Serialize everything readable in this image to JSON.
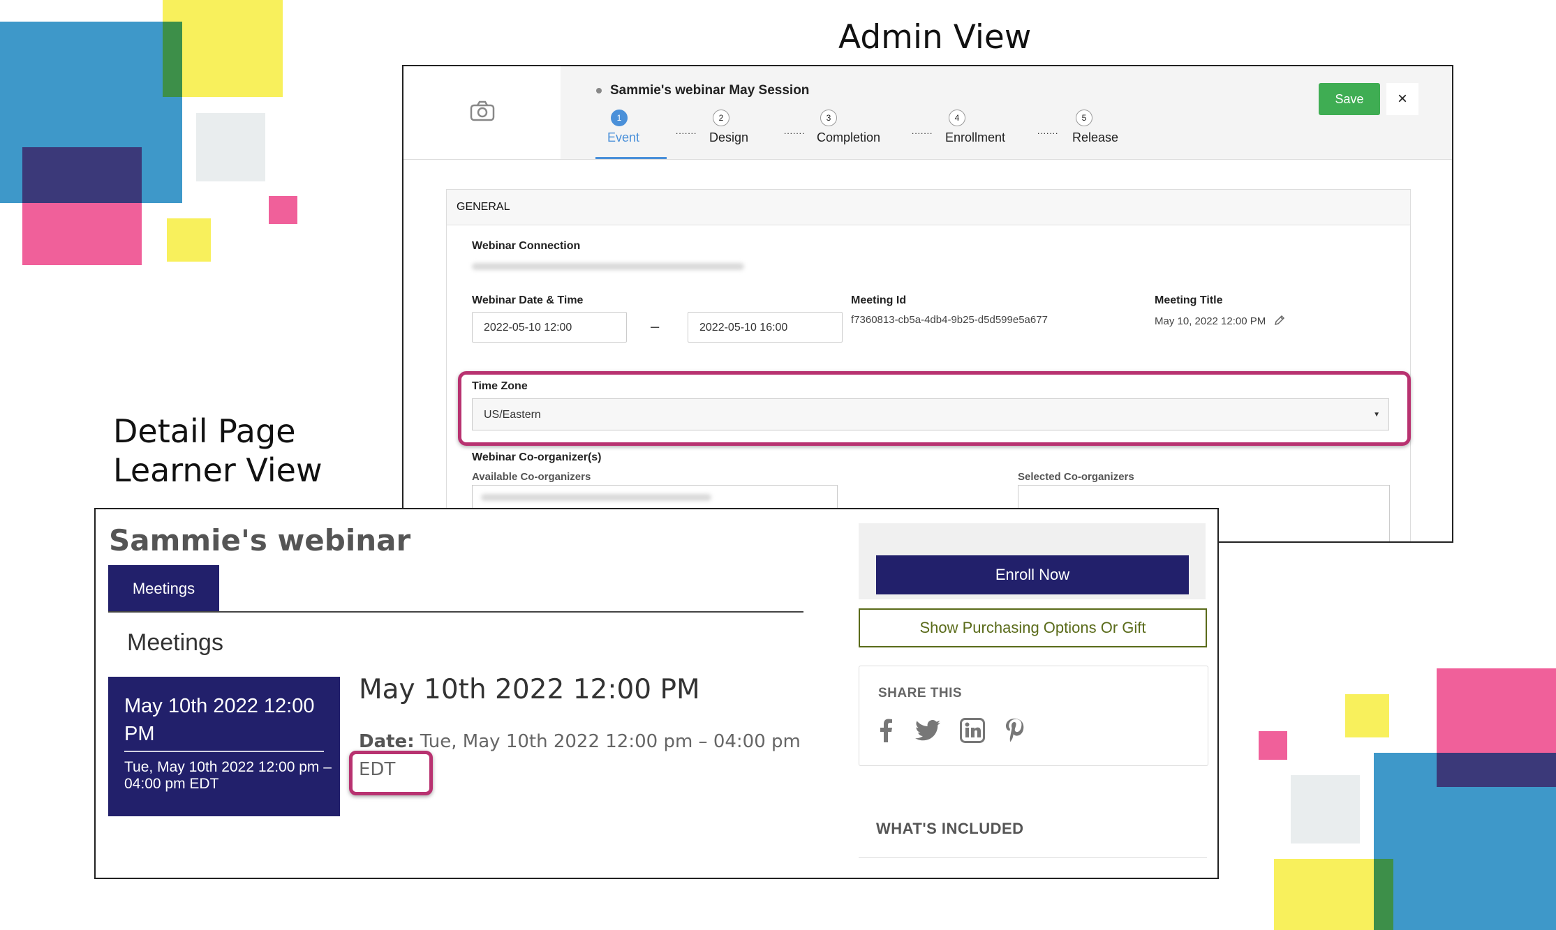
{
  "captions": {
    "admin_view": "Admin View",
    "detail_line1": "Detail Page",
    "detail_line2": "Learner View"
  },
  "admin": {
    "event_title": "Sammie's webinar May Session",
    "steps": [
      {
        "num": "1",
        "label": "Event",
        "active": true
      },
      {
        "num": "2",
        "label": "Design"
      },
      {
        "num": "3",
        "label": "Completion"
      },
      {
        "num": "4",
        "label": "Enrollment"
      },
      {
        "num": "5",
        "label": "Release"
      }
    ],
    "save_label": "Save",
    "close_label": "×",
    "general": {
      "header": "GENERAL",
      "webinar_connection_label": "Webinar Connection",
      "date_time_label": "Webinar Date & Time",
      "start_value": "2022-05-10 12:00",
      "range_sep": "–",
      "end_value": "2022-05-10 16:00",
      "meeting_id_label": "Meeting Id",
      "meeting_id_value": "f7360813-cb5a-4db4-9b25-d5d599e5a677",
      "meeting_title_label": "Meeting Title",
      "meeting_title_value": "May 10, 2022 12:00 PM",
      "time_zone_label": "Time Zone",
      "time_zone_value": "US/Eastern",
      "co_organizers_label": "Webinar Co-organizer(s)",
      "available_label": "Available Co-organizers",
      "selected_label": "Selected Co-organizers"
    }
  },
  "learner": {
    "course_title": "Sammie's webinar",
    "tab_label": "Meetings",
    "section_heading": "Meetings",
    "card_big": "May 10th 2022 12:00 PM",
    "card_small": "Tue, May 10th 2022 12:00 pm – 04:00 pm EDT",
    "meeting_heading": "May 10th 2022 12:00 PM",
    "date_label": "Date:",
    "date_value": " Tue, May 10th 2022 12:00 pm – 04:00 pm",
    "tz_value": "EDT",
    "enroll_label": "Enroll Now",
    "purchase_label": "Show Purchasing Options Or Gift",
    "share_heading": "SHARE THIS",
    "included_heading": "WHAT'S INCLUDED"
  },
  "colors": {
    "navy": "#22206b",
    "green": "#3fad53",
    "highlight": "#b83270",
    "step_active": "#4a90d9",
    "olive": "#5a6b1a"
  },
  "icons": [
    "camera-icon",
    "close-icon",
    "pencil-icon",
    "caret-down-icon",
    "facebook-icon",
    "twitter-icon",
    "linkedin-icon",
    "pinterest-icon"
  ]
}
